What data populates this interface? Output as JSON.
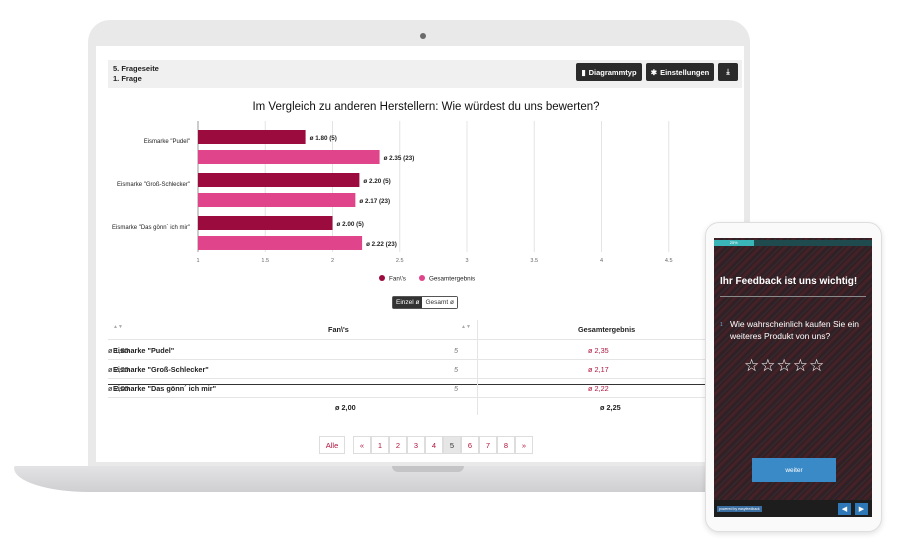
{
  "header": {
    "page_label": "5. Frageseite",
    "question_label": "1. Frage",
    "chart_type_button": "Diagrammtyp",
    "settings_button": "Einstellungen"
  },
  "chart_title": "Im Vergleich zu anderen Herstellern: Wie würdest du uns bewerten?",
  "chart_data": {
    "type": "bar",
    "orientation": "horizontal",
    "title": "Im Vergleich zu anderen Herstellern: Wie würdest du uns bewerten?",
    "categories": [
      "Eismarke \"Pudel\"",
      "Eismarke \"Groß-Schlecker\"",
      "Eismarke \"Das gönn´ ich mir\""
    ],
    "series": [
      {
        "name": "Fan\\'s",
        "values": [
          1.8,
          2.2,
          2.0
        ],
        "labels": [
          "ø 1.80 (5)",
          "ø 2.20 (5)",
          "ø 2.00 (5)"
        ],
        "color": "#9c0b3e"
      },
      {
        "name": "Gesamtergebnis",
        "values": [
          2.35,
          2.17,
          2.22
        ],
        "labels": [
          "ø 2.35 (23)",
          "ø 2.17 (23)",
          "ø 2.22 (23)"
        ],
        "color": "#e0448a"
      }
    ],
    "xlim": [
      1,
      5
    ],
    "ticks": [
      "1",
      "1.5",
      "2",
      "2.5",
      "3",
      "3.5",
      "4",
      "4.5"
    ],
    "grid": true,
    "legend": "bottom"
  },
  "toggle": {
    "single": "Einzel ø",
    "total": "Gesamt ø"
  },
  "table": {
    "col_fans": "Fan\\'s",
    "col_total": "Gesamtergebnis",
    "rows": [
      {
        "name": "Eismarke \"Pudel\"",
        "fans": "ø 1,80",
        "n": "5",
        "total": "ø 2,35"
      },
      {
        "name": "Eismarke \"Groß-Schlecker\"",
        "fans": "ø 2,20",
        "n": "5",
        "total": "ø 2,17"
      },
      {
        "name": "Eismarke \"Das gönn´ ich mir\"",
        "fans": "ø 2,00",
        "n": "5",
        "total": "ø 2,22"
      }
    ],
    "footer_fans": "ø 2,00",
    "footer_total": "ø 2,25"
  },
  "pagination": {
    "all": "Alle",
    "prev": "«",
    "next": "»",
    "pages": [
      "1",
      "2",
      "3",
      "4",
      "5",
      "6",
      "7",
      "8"
    ],
    "current": "5"
  },
  "phone": {
    "progress_label": "25%",
    "progress": 0.25,
    "heading": "Ihr Feedback ist uns wichtig!",
    "question_number": "1",
    "question": "Wie wahrscheinlich kaufen Sie ein weiteres Produkt von uns?",
    "stars": "☆☆☆☆☆",
    "next_button": "weiter",
    "powered": "powered by easyfeedback"
  }
}
